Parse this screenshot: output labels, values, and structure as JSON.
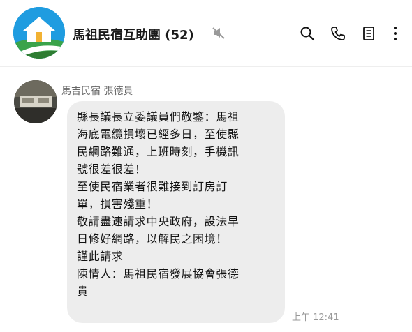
{
  "header": {
    "group_name": "馬祖民宿互助團",
    "member_count": "(52)",
    "icons": [
      "mute-icon",
      "search-icon",
      "phone-icon",
      "notes-icon",
      "more-icon"
    ]
  },
  "message": {
    "sender": "馬吉民宿 張德貴",
    "lines": [
      "縣長議長立委議員們敬鑒：馬祖",
      "海底電纜損壞已經多日，至使縣",
      "民網路難通，上班時刻，手機訊",
      "號很差很差！",
      "至使民宿業者很難接到訂房訂",
      "單，損害殘重！",
      "敬請盡速請求中央政府，設法早",
      "日修好網路，以解民之困境！",
      "謹此請求",
      "陳情人：馬祖民宿發展協會張德",
      "貴"
    ],
    "time": "上午 12:41"
  },
  "colors": {
    "avatar_sky": "#1f9ce0",
    "bubble": "#ededed"
  }
}
